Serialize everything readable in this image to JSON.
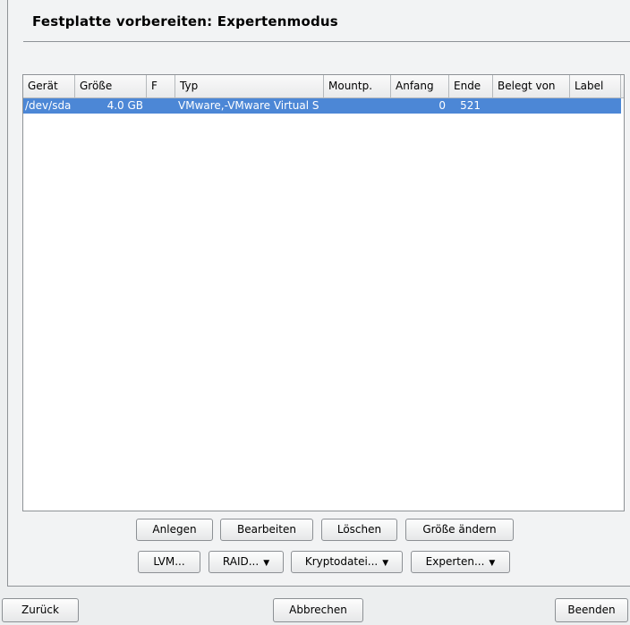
{
  "dialog": {
    "title": "Festplatte vorbereiten: Expertenmodus"
  },
  "table": {
    "columns": [
      "Gerät",
      "Größe",
      "F",
      "Typ",
      "Mountp.",
      "Anfang",
      "Ende",
      "Belegt von",
      "Label"
    ],
    "rows": [
      {
        "device": "/dev/sda",
        "size": "4.0 GB",
        "f": "",
        "type": "VMware,-VMware Virtual S",
        "mountpoint": "",
        "start": "0",
        "end": "521",
        "used_by": "",
        "label": ""
      }
    ]
  },
  "actions": {
    "create": "Anlegen",
    "edit": "Bearbeiten",
    "delete": "Löschen",
    "resize": "Größe ändern",
    "lvm": "LVM...",
    "raid": "RAID...",
    "crypt": "Kryptodatei...",
    "expert": "Experten..."
  },
  "footer": {
    "back": "Zurück",
    "abort": "Abbrechen",
    "finish": "Beenden"
  },
  "colors": {
    "selection": "#4c87d6"
  }
}
